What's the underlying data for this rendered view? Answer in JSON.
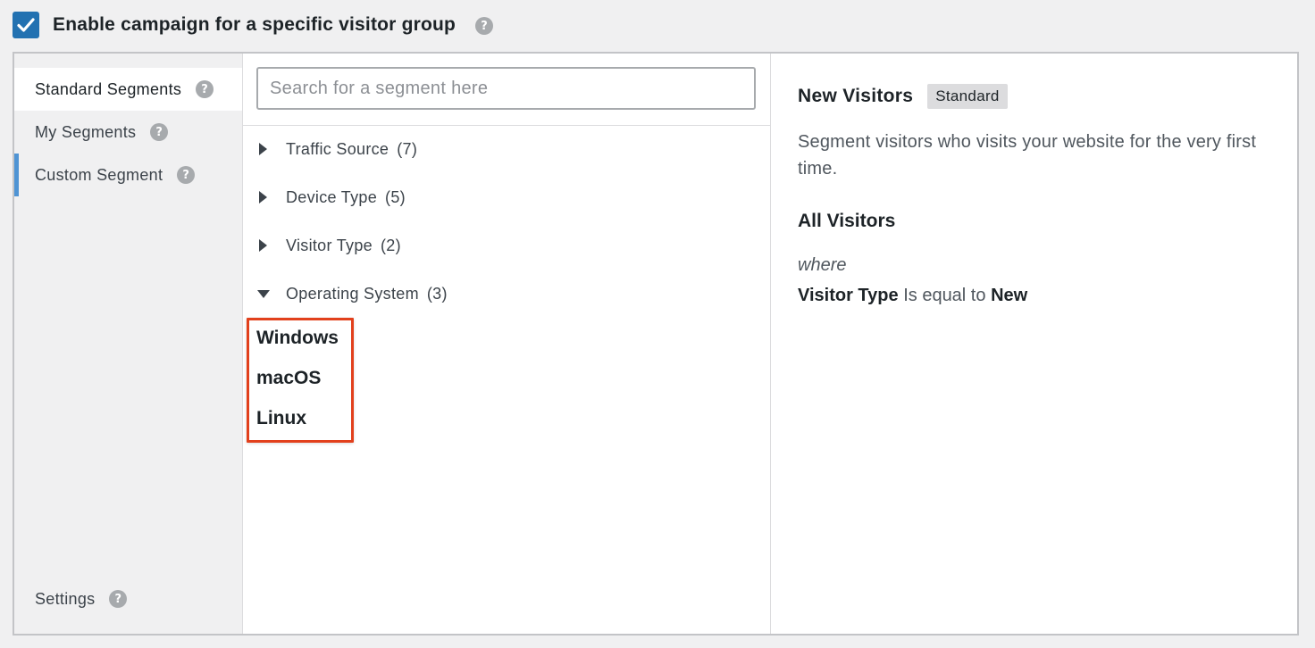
{
  "header": {
    "enable_label": "Enable campaign for a specific visitor group",
    "checked": true,
    "help": "?"
  },
  "sidebar": {
    "items": [
      {
        "label": "Standard Segments",
        "help": "?"
      },
      {
        "label": "My Segments",
        "help": "?"
      },
      {
        "label": "Custom Segment",
        "help": "?"
      }
    ],
    "settings": {
      "label": "Settings",
      "help": "?"
    }
  },
  "search": {
    "placeholder": "Search for a segment here",
    "value": ""
  },
  "groups": [
    {
      "label": "Traffic Source",
      "count": "(7)",
      "expanded": false
    },
    {
      "label": "Device Type",
      "count": "(5)",
      "expanded": false
    },
    {
      "label": "Visitor Type",
      "count": "(2)",
      "expanded": false
    },
    {
      "label": "Operating System",
      "count": "(3)",
      "expanded": true
    }
  ],
  "os_items": [
    "Windows",
    "macOS",
    "Linux"
  ],
  "detail": {
    "title": "New Visitors",
    "badge": "Standard",
    "description": "Segment visitors who visits your website for the very first time.",
    "all_label": "All Visitors",
    "where": "where",
    "rule": {
      "field": "Visitor Type",
      "operator": "Is equal to",
      "value": "New"
    }
  },
  "colors": {
    "accent": "#2271b1",
    "highlight": "#e2401c",
    "active_marker": "#4f94d4"
  }
}
